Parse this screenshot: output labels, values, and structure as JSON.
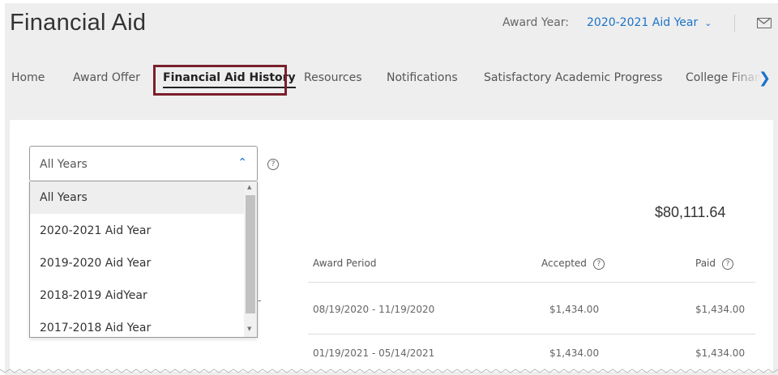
{
  "header": {
    "title": "Financial Aid",
    "award_year_label": "Award Year:",
    "award_year_value": "2020-2021 Aid Year"
  },
  "nav": {
    "items": [
      {
        "label": "Home"
      },
      {
        "label": "Award Offer"
      },
      {
        "label": "Financial Aid History",
        "active": true
      },
      {
        "label": "Resources"
      },
      {
        "label": "Notifications"
      },
      {
        "label": "Satisfactory Academic Progress"
      },
      {
        "label": "College Finan"
      }
    ]
  },
  "filter": {
    "selected": "All Years",
    "options": [
      "All Years",
      "2020-2021 Aid Year",
      "2019-2020 Aid Year",
      "2018-2019 AidYear",
      "2017-2018 Aid Year"
    ]
  },
  "summary": {
    "total": "$80,111.64"
  },
  "table": {
    "headers": {
      "award_period": "Award Period",
      "accepted": "Accepted",
      "paid": "Paid"
    },
    "rows": [
      {
        "period": "08/19/2020 - 11/19/2020",
        "accepted": "$1,434.00",
        "paid": "$1,434.00"
      },
      {
        "period": "01/19/2021 - 05/14/2021",
        "accepted": "$1,434.00",
        "paid": "$1,434.00"
      }
    ],
    "row_fragment": "-"
  },
  "colors": {
    "accent": "#1a73c8",
    "highlight": "#7a1f2b"
  },
  "icons": [
    "chevron-down-icon",
    "mail-icon",
    "chevron-right-icon",
    "chevron-up-icon",
    "help-icon"
  ]
}
